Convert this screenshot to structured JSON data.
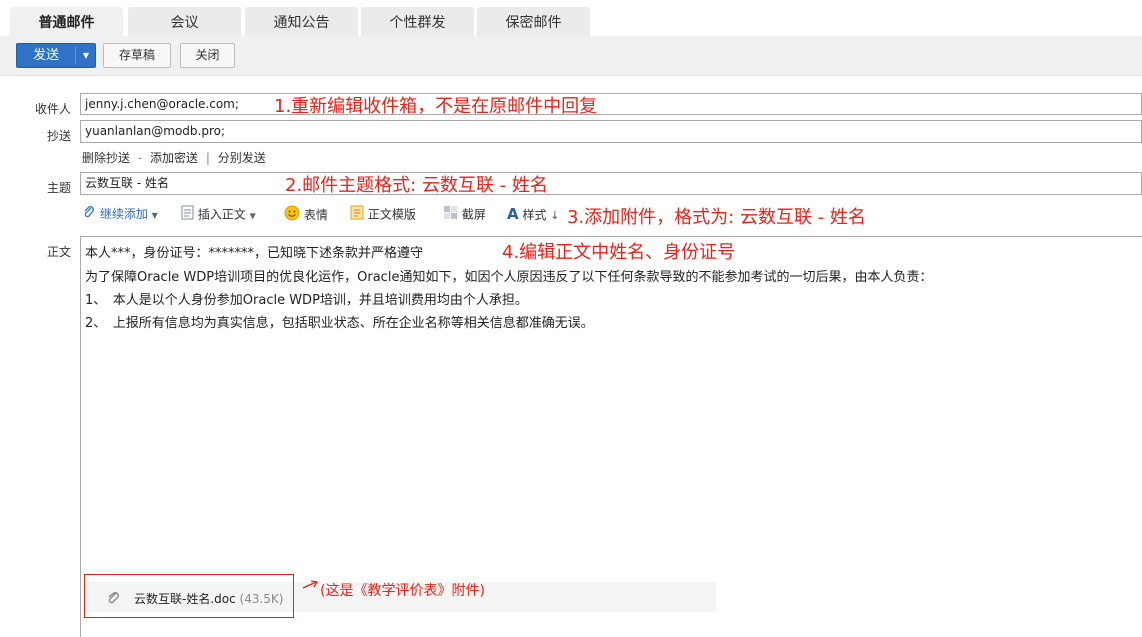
{
  "tabs": [
    {
      "label": "普通邮件",
      "active": true
    },
    {
      "label": "会议",
      "active": false
    },
    {
      "label": "通知公告",
      "active": false
    },
    {
      "label": "个性群发",
      "active": false
    },
    {
      "label": "保密邮件",
      "active": false
    }
  ],
  "toolbar": {
    "send_label": "发送",
    "save_draft_label": "存草稿",
    "close_label": "关闭"
  },
  "to": {
    "label": "收件人",
    "value": "jenny.j.chen@oracle.com;"
  },
  "cc": {
    "label": "抄送",
    "value": "yuanlanlan@modb.pro;"
  },
  "recipient_links": {
    "delete_cc": "删除抄送",
    "add_bcc": "添加密送",
    "separate_send": "分别发送",
    "dash": "-",
    "bar": "|"
  },
  "subject": {
    "label": "主题",
    "value": "云数互联 - 姓名"
  },
  "editor_tools": {
    "continue_add": "继续添加",
    "insert_body": "插入正文",
    "emoji": "表情",
    "template": "正文模版",
    "screenshot": "截屏",
    "style": "样式"
  },
  "body": {
    "label": "正文",
    "lines": [
      "本人***，身份证号：*******，已知晓下述条款并严格遵守",
      "为了保障Oracle WDP培训项目的优良化运作，Oracle通知如下，如因个人原因违反了以下任何条款导致的不能参加考试的一切后果，由本人负责：",
      "1、　本人是以个人身份参加Oracle WDP培训，并且培训费用均由个人承担。",
      "2、　上报所有信息均为真实信息，包括职业状态、所在企业名称等相关信息都准确无误。"
    ]
  },
  "attachment": {
    "name": "云数互联-姓名.doc",
    "size": "(43.5K)"
  },
  "annotations": {
    "note1": "1.重新编辑收件箱，不是在原邮件中回复",
    "note2": "2.邮件主题格式: 云数互联 - 姓名",
    "note3": "3.添加附件，格式为: 云数互联 - 姓名",
    "note4": "4.编辑正文中姓名、身份证号",
    "note5": "(这是《教学评价表》附件)"
  },
  "colors": {
    "accent": "#2f73c4",
    "annotation": "#e8231b"
  }
}
